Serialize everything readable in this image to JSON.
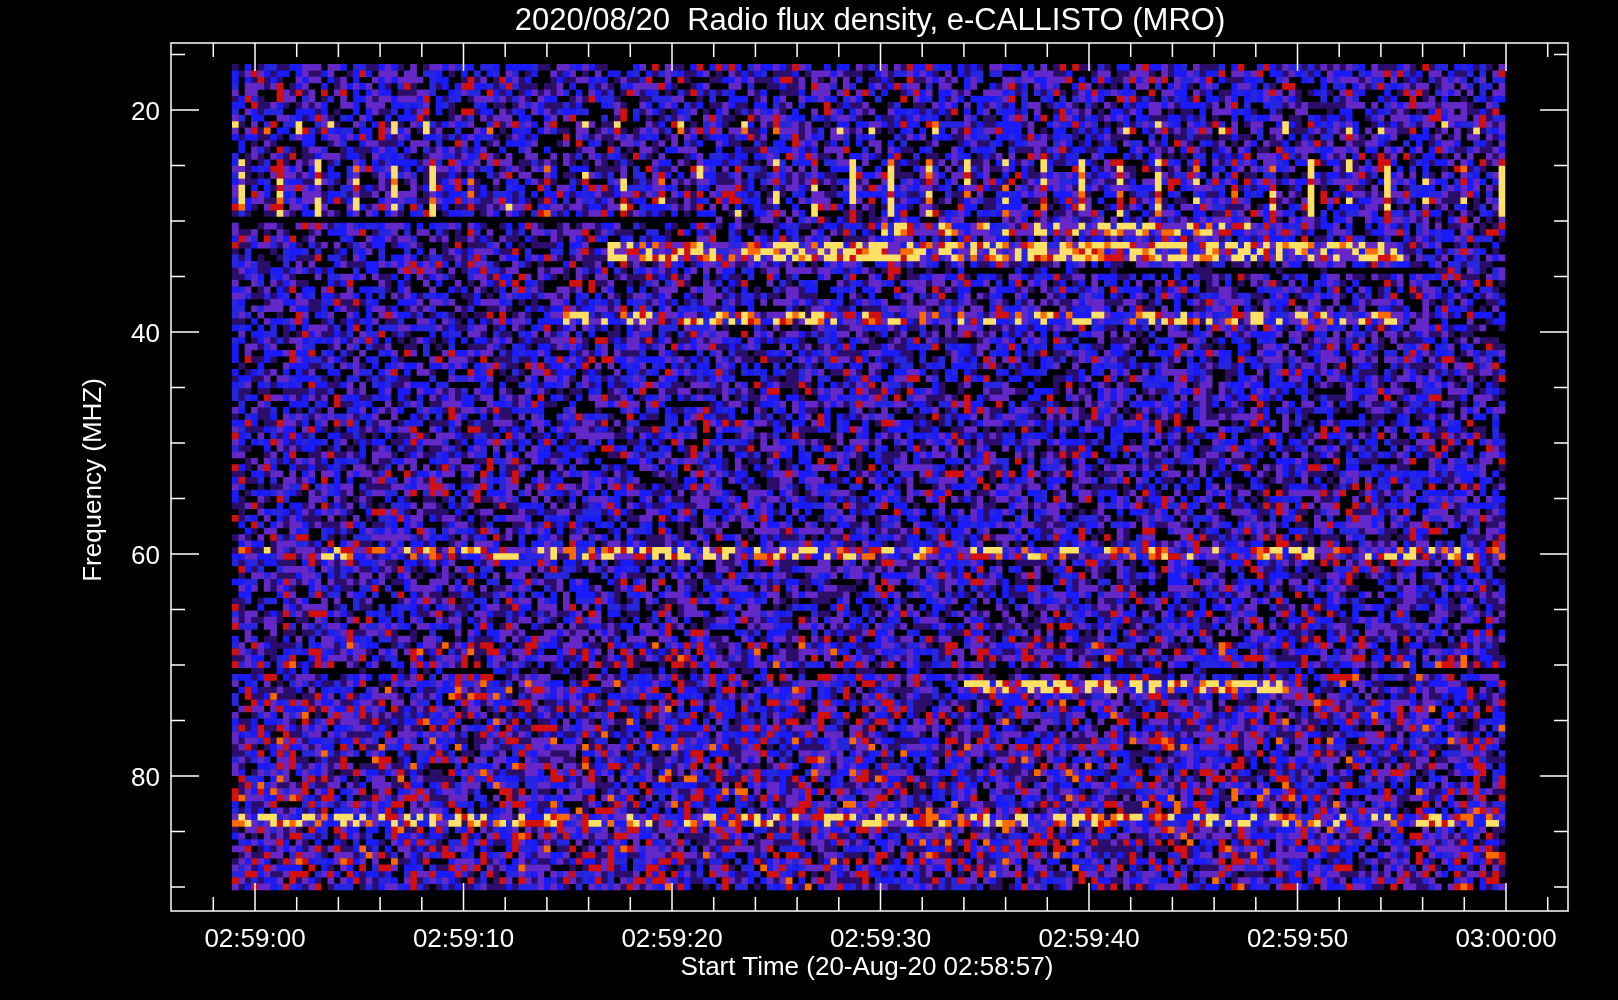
{
  "title": "2020/08/20  Radio flux density, e-CALLISTO (MRO)",
  "x_axis": {
    "label": "Start Time (20-Aug-20 02:58:57)",
    "ticks": [
      "02:59:00",
      "02:59:10",
      "02:59:20",
      "02:59:30",
      "02:59:40",
      "02:59:50",
      "03:00:00"
    ]
  },
  "y_axis": {
    "label": "Frequency (MHZ)",
    "ticks": [
      "20",
      "40",
      "60",
      "80"
    ]
  }
}
